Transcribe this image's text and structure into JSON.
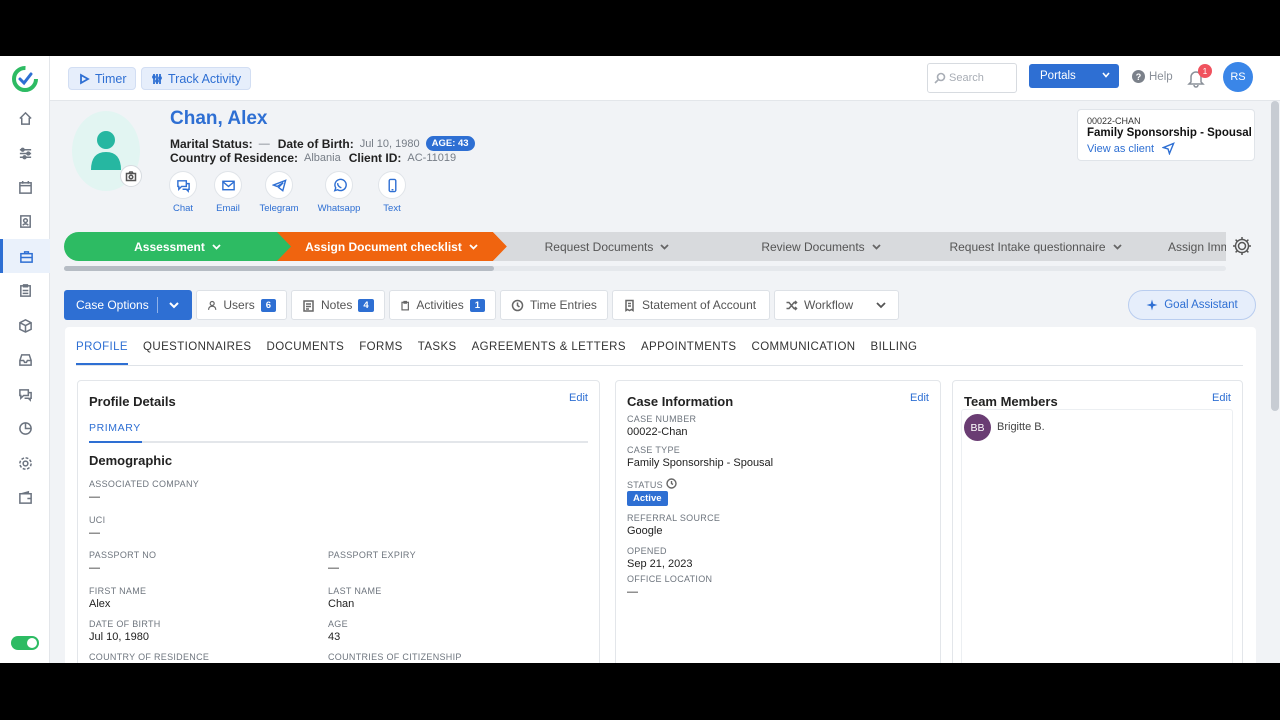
{
  "topbar": {
    "timer_label": "Timer",
    "track_label": "Track Activity",
    "search_placeholder": "Search",
    "portals_label": "Portals",
    "help_label": "Help",
    "notif_count": "1",
    "user_initials": "RS"
  },
  "client": {
    "name": "Chan, Alex",
    "marital_label": "Marital Status:",
    "marital_value": "—",
    "dob_label": "Date of Birth:",
    "dob_value": "Jul 10, 1980",
    "age_badge": "AGE: 43",
    "country_label": "Country of Residence:",
    "country_value": "Albania",
    "client_id_label": "Client ID:",
    "client_id_value": "AC-11019"
  },
  "contacts": [
    {
      "label": "Chat",
      "icon": "chat-icon"
    },
    {
      "label": "Email",
      "icon": "email-icon"
    },
    {
      "label": "Telegram",
      "icon": "telegram-icon"
    },
    {
      "label": "Whatsapp",
      "icon": "whatsapp-icon"
    },
    {
      "label": "Text",
      "icon": "phone-icon"
    }
  ],
  "case_card": {
    "number": "00022-CHAN",
    "type": "Family Sponsorship - Spousal",
    "view_link": "View as client"
  },
  "stages": [
    {
      "label": "Assessment",
      "status": "complete",
      "color": "#2dbb63"
    },
    {
      "label": "Assign Document checklist",
      "status": "current",
      "color": "#f0640f"
    },
    {
      "label": "Request Documents",
      "status": "pending",
      "color": "#d8dadd"
    },
    {
      "label": "Review Documents",
      "status": "pending",
      "color": "#d8dadd"
    },
    {
      "label": "Request Intake questionnaire",
      "status": "pending",
      "color": "#d8dadd"
    },
    {
      "label": "Assign Imm",
      "status": "pending",
      "color": "#d8dadd"
    }
  ],
  "actions": {
    "case_options": "Case Options",
    "users": "Users",
    "users_count": "6",
    "notes": "Notes",
    "notes_count": "4",
    "activities": "Activities",
    "activities_count": "1",
    "time_entries": "Time Entries",
    "statement": "Statement of Account",
    "workflow": "Workflow",
    "goal": "Goal Assistant"
  },
  "tabs": [
    "PROFILE",
    "QUESTIONNAIRES",
    "DOCUMENTS",
    "FORMS",
    "TASKS",
    "AGREEMENTS & LETTERS",
    "APPOINTMENTS",
    "COMMUNICATION",
    "BILLING"
  ],
  "profile": {
    "title": "Profile Details",
    "edit": "Edit",
    "primary_tab": "PRIMARY",
    "section": "Demographic",
    "fields": {
      "assoc_company_label": "ASSOCIATED COMPANY",
      "assoc_company": "—",
      "uci_label": "UCI",
      "uci": "—",
      "passport_label": "PASSPORT NO",
      "passport": "—",
      "passport_exp_label": "PASSPORT EXPIRY",
      "passport_exp": "—",
      "first_name_label": "FIRST NAME",
      "first_name": "Alex",
      "last_name_label": "LAST NAME",
      "last_name": "Chan",
      "dob_label": "DATE OF BIRTH",
      "dob": "Jul 10, 1980",
      "age_label": "AGE",
      "age": "43",
      "country_res_label": "COUNTRY OF RESIDENCE",
      "citizenship_label": "COUNTRIES OF CITIZENSHIP"
    }
  },
  "case_info": {
    "title": "Case Information",
    "edit": "Edit",
    "case_number_label": "CASE NUMBER",
    "case_number": "00022-Chan",
    "case_type_label": "CASE TYPE",
    "case_type": "Family Sponsorship - Spousal",
    "status_label": "STATUS",
    "status": "Active",
    "referral_label": "REFERRAL SOURCE",
    "referral": "Google",
    "opened_label": "OPENED",
    "opened": "Sep 21, 2023",
    "office_label": "OFFICE LOCATION",
    "office": "—"
  },
  "team": {
    "title": "Team Members",
    "edit": "Edit",
    "members": [
      {
        "initials": "BB",
        "name": "Brigitte B."
      }
    ]
  }
}
